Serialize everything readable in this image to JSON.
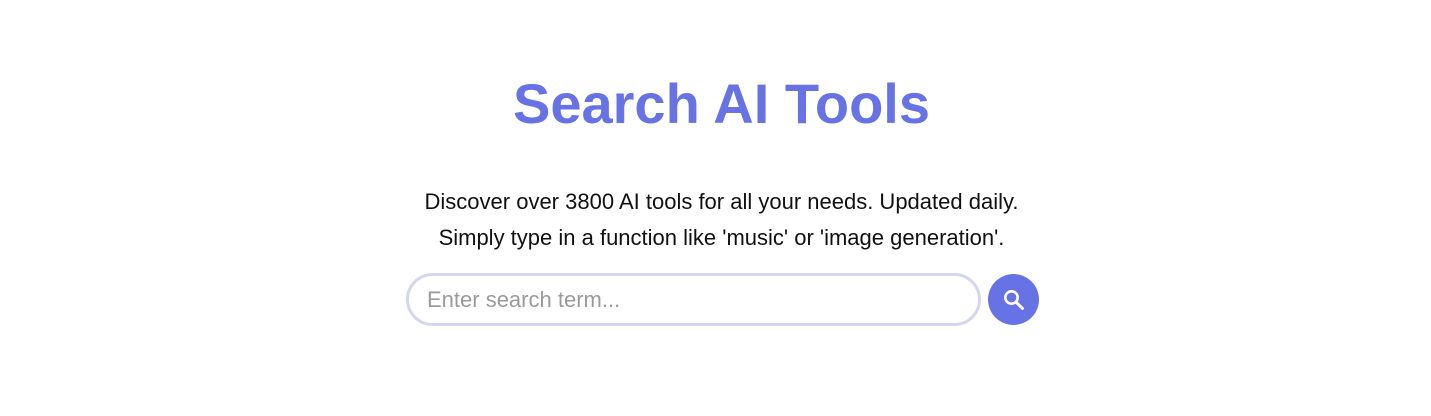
{
  "header": {
    "title": "Search AI Tools"
  },
  "intro": {
    "line1": "Discover over 3800 AI tools for all your needs. Updated daily.",
    "line2": "Simply type in a function like 'music' or 'image generation'."
  },
  "search": {
    "placeholder": "Enter search term...",
    "value": "",
    "button_icon": "search-icon"
  },
  "colors": {
    "accent": "#6772e5",
    "input_border": "#d4d6ef"
  }
}
